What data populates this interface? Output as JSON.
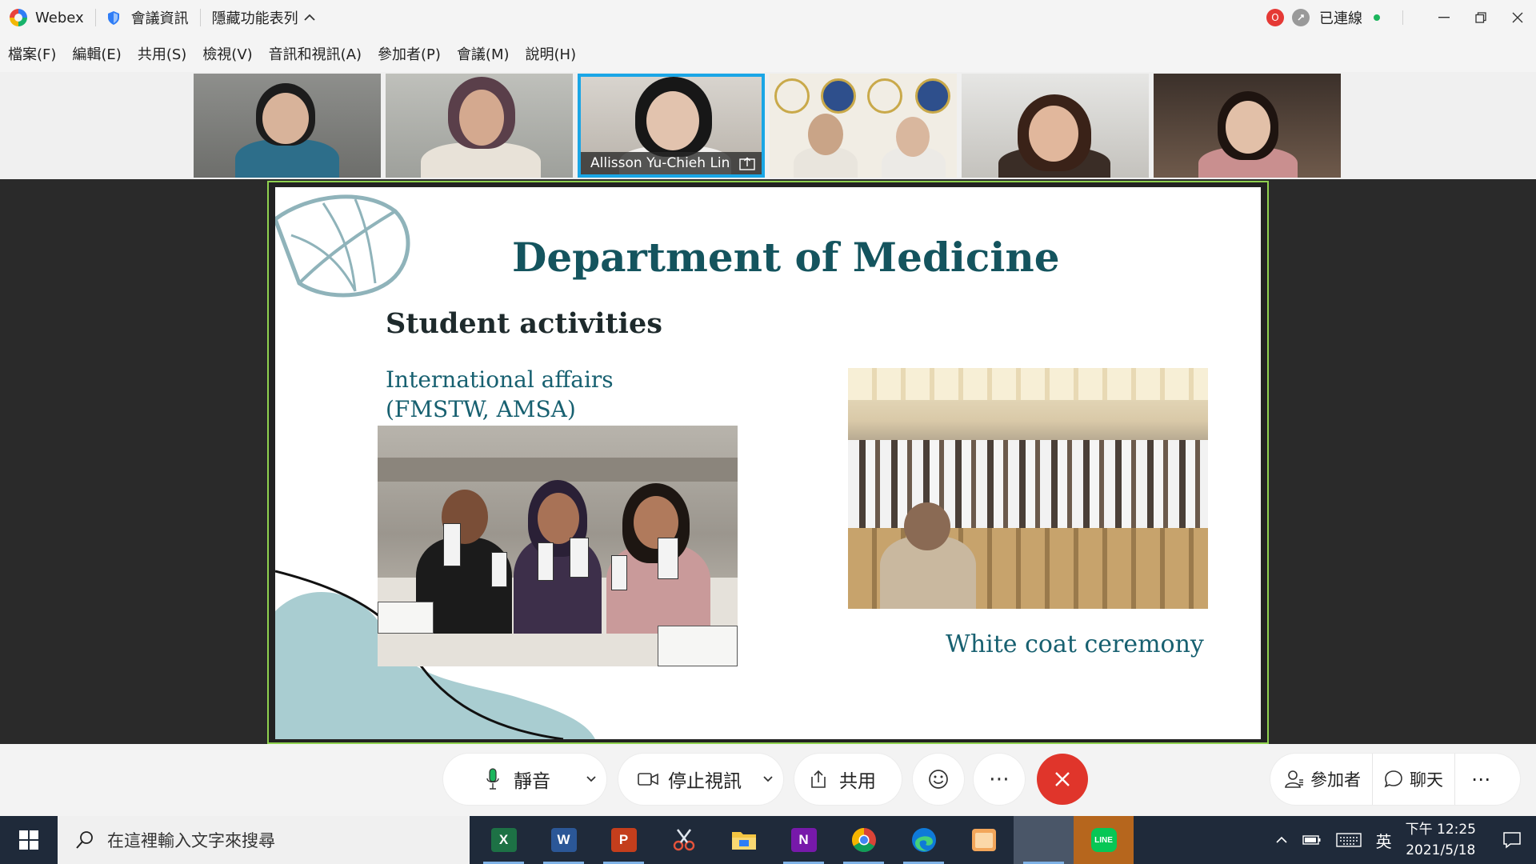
{
  "window": {
    "app_name": "Webex",
    "meeting_info": "會議資訊",
    "hide_menu": "隱藏功能表列",
    "connection_status": "已連線",
    "rec_badge": "O"
  },
  "menu": [
    "檔案(F)",
    "編輯(E)",
    "共用(S)",
    "檢視(V)",
    "音訊和視訊(A)",
    "參加者(P)",
    "會議(M)",
    "說明(H)"
  ],
  "participants": {
    "active_speaker_name": "Allisson Yu-Chieh Lin"
  },
  "slide": {
    "title": "Department of Medicine",
    "subtitle": "Student activities",
    "intl_line1": "International affairs",
    "intl_line2": "(FMSTW, AMSA)",
    "caption": "White coat ceremony"
  },
  "controls": {
    "mute": "靜音",
    "stop_video": "停止視訊",
    "share": "共用",
    "more": "⋯",
    "participants": "參加者",
    "chat": "聊天",
    "more_right": "⋯"
  },
  "taskbar": {
    "search_placeholder": "在這裡輸入文字來搜尋",
    "ime": "英",
    "time": "下午 12:25",
    "date": "2021/5/18"
  },
  "colors": {
    "slide_title": "#14545e",
    "speaker_border": "#1aa6e6",
    "share_border": "#8fd14f",
    "end_call": "#e0352b",
    "taskbar": "#1f2a3a"
  },
  "icons": {
    "excel": "X",
    "word": "W",
    "powerpoint": "P",
    "onenote": "N",
    "line": "LINE"
  }
}
